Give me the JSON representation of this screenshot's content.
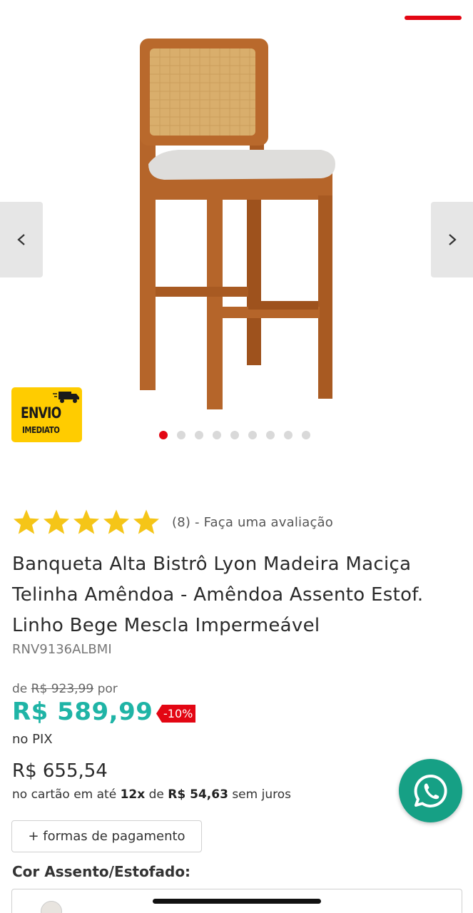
{
  "gallery": {
    "prev_icon": "chevron-left-icon",
    "next_icon": "chevron-right-icon",
    "badge_line1": "ENVIO",
    "badge_line2": "IMEDIATO",
    "badge_icon": "delivery-truck-icon",
    "image_count": 9,
    "active_index": 0
  },
  "rating": {
    "stars": 5,
    "text": "(8) - Faça uma avaliação"
  },
  "product": {
    "title": "Banqueta Alta Bistrô Lyon Madeira Maciça Telinha Amêndoa - Amêndoa Assento Estof. Linho Bege Mescla Impermeável",
    "sku": "RNV9136ALBMI"
  },
  "price": {
    "old_prefix": "de",
    "old_value": "R$ 923,99",
    "old_suffix": "por",
    "pix_value": "R$ 589,99",
    "discount": "-10%",
    "pix_label": "no PIX",
    "card_value": "R$ 655,54",
    "installments": {
      "prefix": "no cartão em até",
      "count": "12x",
      "mid": "de",
      "amount": "R$ 54,63",
      "suffix": "sem juros"
    },
    "payment_button": "+ formas de pagamento"
  },
  "options": {
    "color_label": "Cor Assento/Estofado:"
  },
  "colors": {
    "accent": "#e30613",
    "pix": "#1fb4a6",
    "whatsapp": "#16a085",
    "star": "#f5c518",
    "badge": "#ffcc00"
  },
  "whatsapp": {
    "icon": "whatsapp-icon"
  }
}
